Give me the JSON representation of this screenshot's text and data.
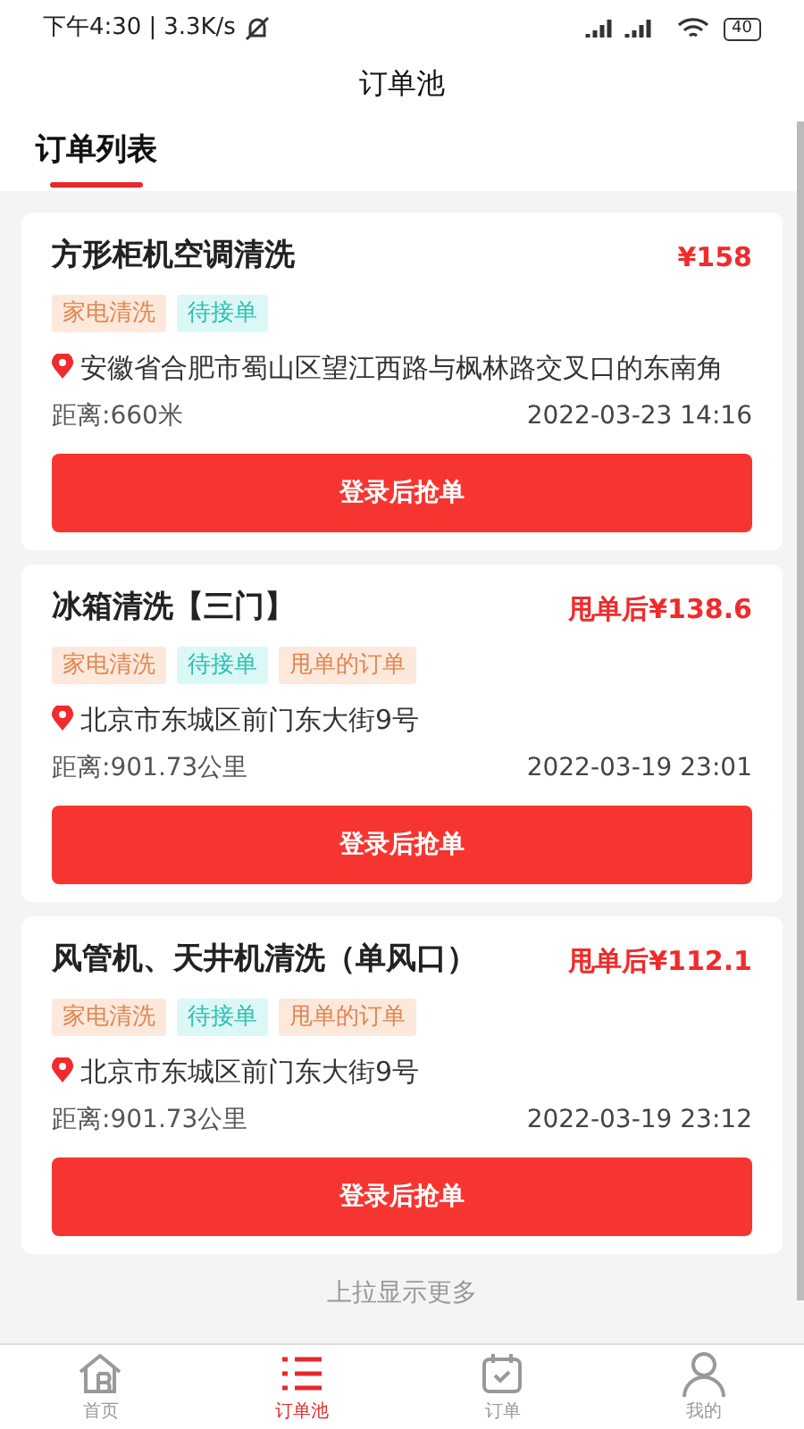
{
  "status_bar": {
    "time": "下午4:30",
    "separator": "|",
    "speed": "3.3K/s",
    "battery": "40"
  },
  "header": {
    "title": "订单池"
  },
  "tabs": [
    {
      "label": "订单列表",
      "selected": true
    }
  ],
  "orders": [
    {
      "title": "方形柜机空调清洗",
      "price": "¥158",
      "tags": [
        {
          "label": "家电清洗",
          "kind": "category"
        },
        {
          "label": "待接单",
          "kind": "status"
        }
      ],
      "address": "安徽省合肥市蜀山区望江西路与枫林路交叉口的东南角",
      "distance": "距离:660米",
      "time": "2022-03-23 14:16",
      "button": "登录后抢单"
    },
    {
      "title": "冰箱清洗【三门】",
      "price": "甩单后¥138.6",
      "tags": [
        {
          "label": "家电清洗",
          "kind": "category"
        },
        {
          "label": "待接单",
          "kind": "status"
        },
        {
          "label": "甩单的订单",
          "kind": "transfer"
        }
      ],
      "address": "北京市东城区前门东大街9号",
      "distance": "距离:901.73公里",
      "time": "2022-03-19 23:01",
      "button": "登录后抢单"
    },
    {
      "title": "风管机、天井机清洗（单风口）",
      "price": "甩单后¥112.1",
      "tags": [
        {
          "label": "家电清洗",
          "kind": "category"
        },
        {
          "label": "待接单",
          "kind": "status"
        },
        {
          "label": "甩单的订单",
          "kind": "transfer"
        }
      ],
      "address": "北京市东城区前门东大街9号",
      "distance": "距离:901.73公里",
      "time": "2022-03-19 23:12",
      "button": "登录后抢单"
    }
  ],
  "load_more": "上拉显示更多",
  "bottom_nav": [
    {
      "label": "首页",
      "selected": false,
      "kind": "home"
    },
    {
      "label": "订单池",
      "selected": true,
      "kind": "list"
    },
    {
      "label": "订单",
      "selected": false,
      "kind": "calendar"
    },
    {
      "label": "我的",
      "selected": false,
      "kind": "user"
    }
  ]
}
